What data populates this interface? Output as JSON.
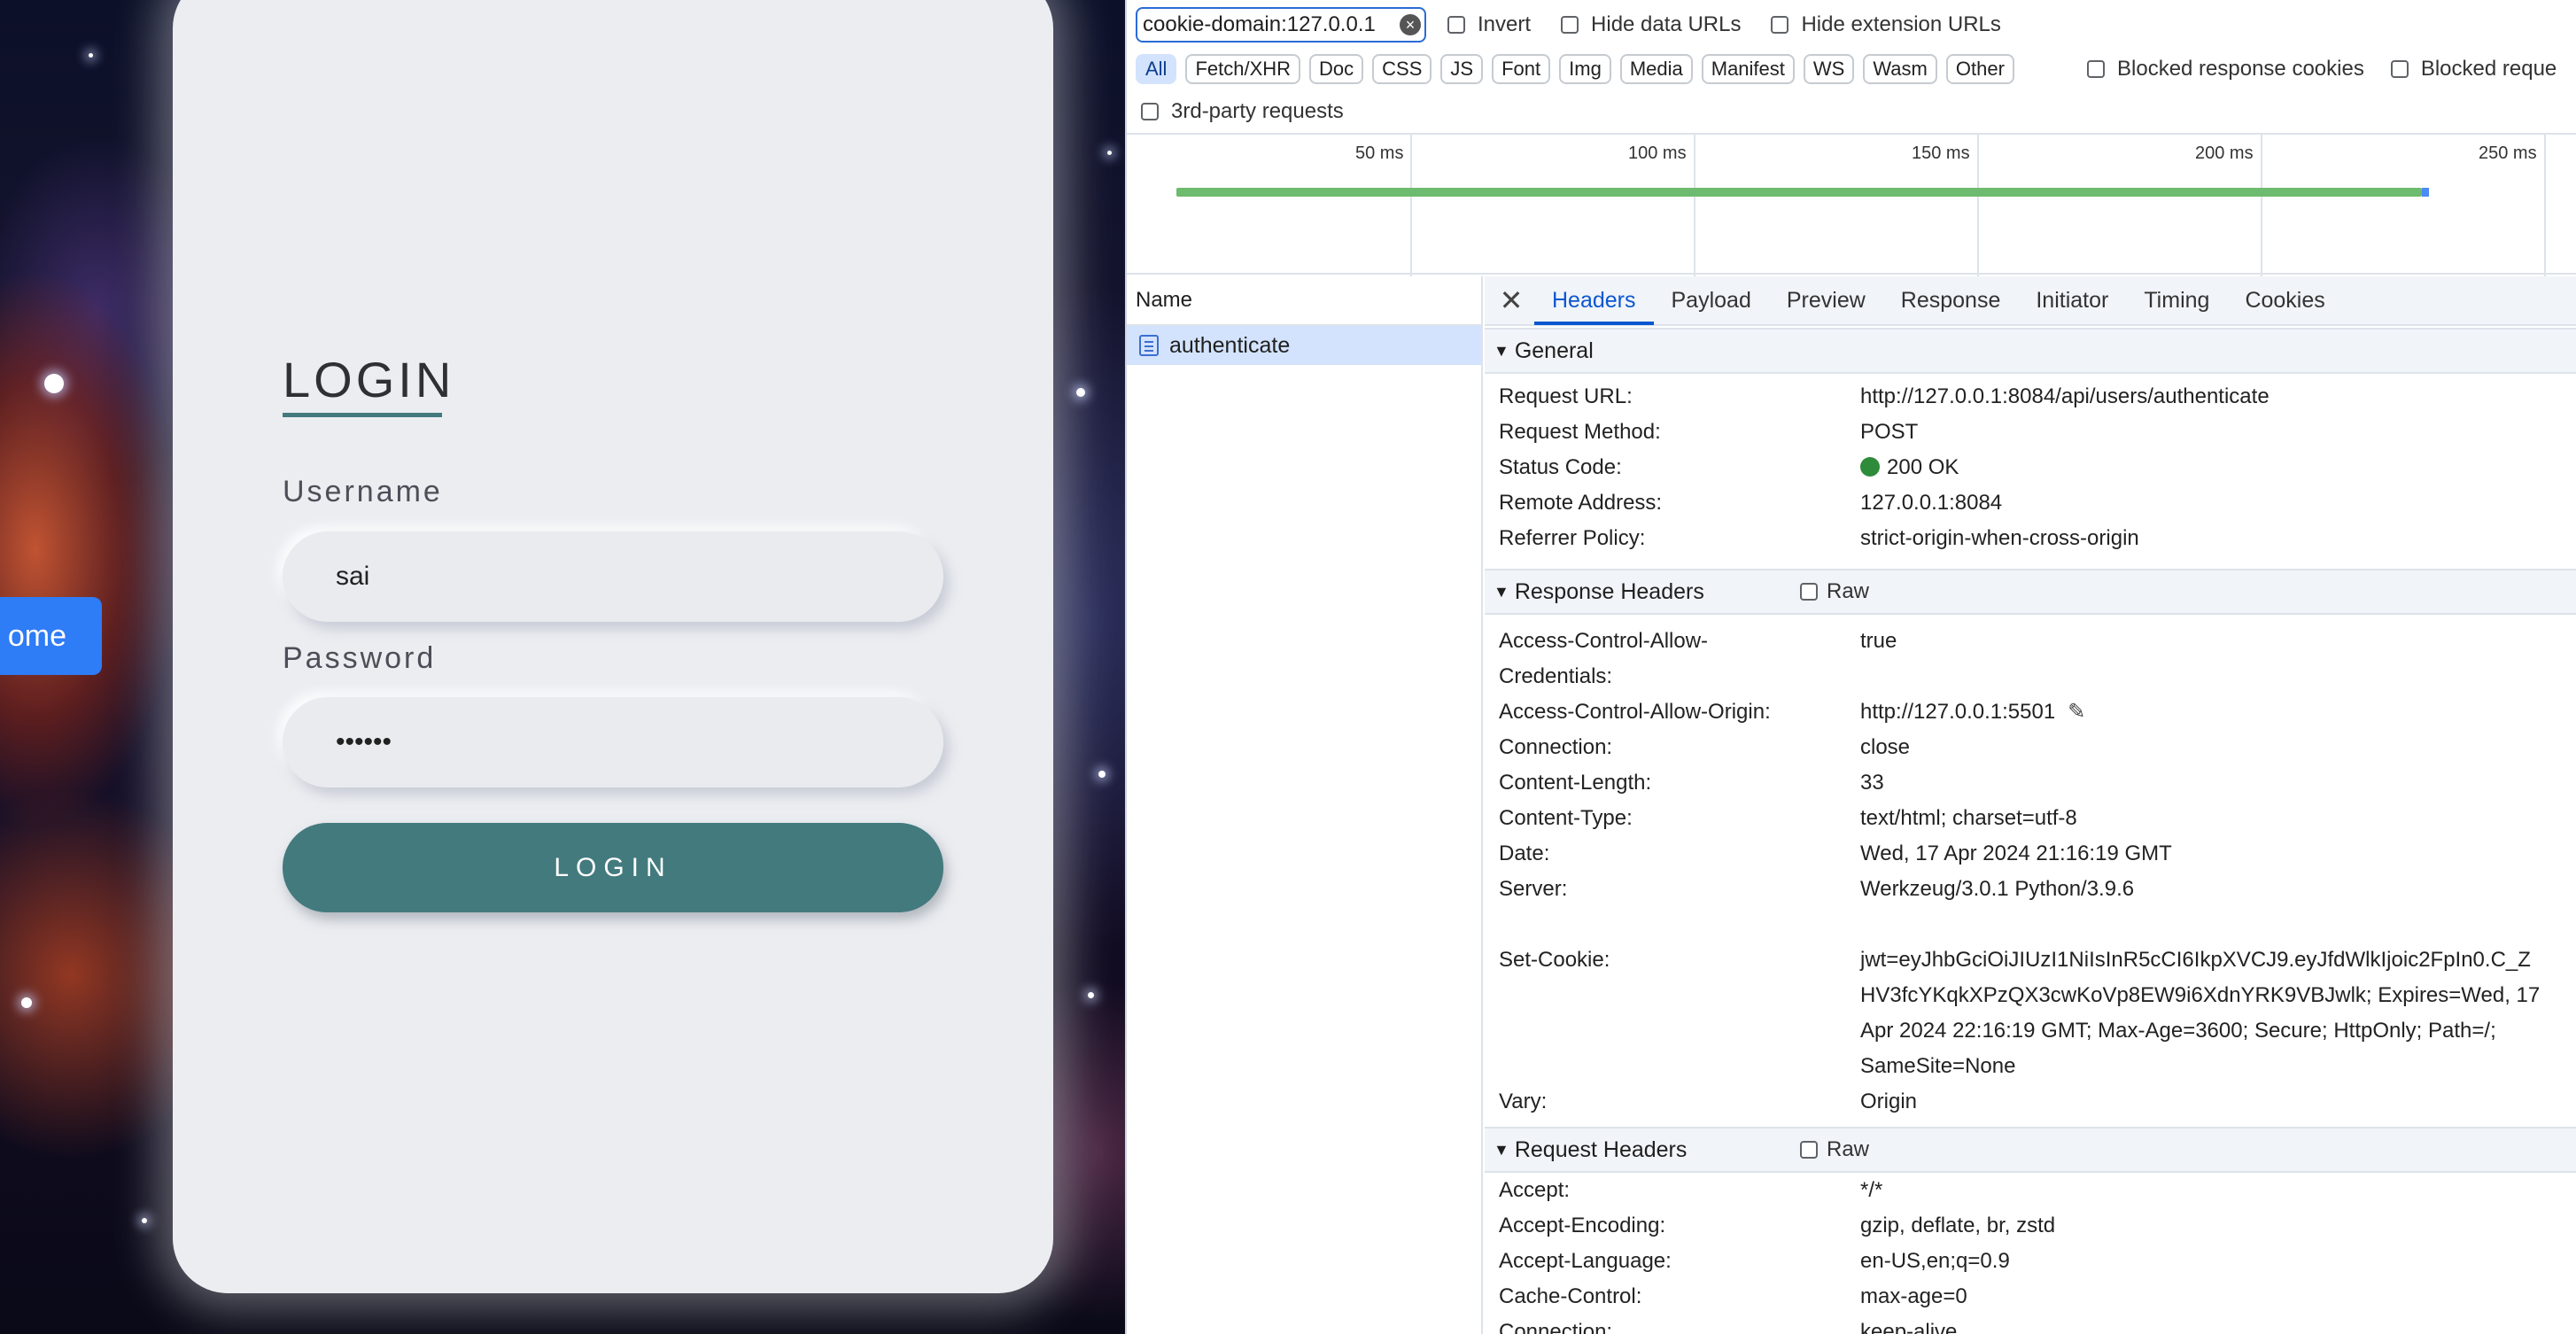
{
  "login_page": {
    "title": "LOGIN",
    "username_label": "Username",
    "username_value": "sai",
    "password_label": "Password",
    "password_value": "••••••",
    "login_button": "LOGIN",
    "home_button": "ome"
  },
  "devtools": {
    "filter_value": "cookie-domain:127.0.0.1",
    "filter_clear_icon": "clear-circle-icon",
    "invert": "Invert",
    "hide_data_urls": "Hide data URLs",
    "hide_extension_urls": "Hide extension URLs",
    "type_filters": [
      "All",
      "Fetch/XHR",
      "Doc",
      "CSS",
      "JS",
      "Font",
      "Img",
      "Media",
      "Manifest",
      "WS",
      "Wasm",
      "Other"
    ],
    "active_filter": "All",
    "blocked_response_cookies": "Blocked response cookies",
    "blocked_requests": "Blocked reque",
    "third_party": "3rd-party requests",
    "timeline_ticks": [
      "50 ms",
      "100 ms",
      "150 ms",
      "200 ms",
      "250 ms"
    ],
    "name_header": "Name",
    "request_name": "authenticate",
    "tabs": [
      "Headers",
      "Payload",
      "Preview",
      "Response",
      "Initiator",
      "Timing",
      "Cookies"
    ],
    "active_tab": "Headers",
    "general": {
      "title": "General",
      "rows": [
        {
          "k": "Request URL:",
          "v": "http://127.0.0.1:8084/api/users/authenticate"
        },
        {
          "k": "Request Method:",
          "v": "POST"
        },
        {
          "k": "Status Code:",
          "v": "200 OK"
        },
        {
          "k": "Remote Address:",
          "v": "127.0.0.1:8084"
        },
        {
          "k": "Referrer Policy:",
          "v": "strict-origin-when-cross-origin"
        }
      ]
    },
    "response_headers": {
      "title": "Response Headers",
      "raw": "Raw",
      "acac_k1": "Access-Control-Allow-",
      "acac_k2": "Credentials:",
      "acac_v": "true",
      "acao_k": "Access-Control-Allow-Origin:",
      "acao_v": "http://127.0.0.1:5501",
      "rows": [
        {
          "k": "Connection:",
          "v": "close"
        },
        {
          "k": "Content-Length:",
          "v": "33"
        },
        {
          "k": "Content-Type:",
          "v": "text/html; charset=utf-8"
        },
        {
          "k": "Date:",
          "v": "Wed, 17 Apr 2024 21:16:19 GMT"
        },
        {
          "k": "Server:",
          "v": "Werkzeug/3.0.1 Python/3.9.6"
        }
      ],
      "set_cookie_k": "Set-Cookie:",
      "set_cookie_lines": [
        "jwt=eyJhbGciOiJIUzI1NiIsInR5cCI6IkpXVCJ9.eyJfdWlkIjoic2FpIn0.C_Z",
        "HV3fcYKqkXPzQX3cwKoVp8EW9i6XdnYRK9VBJwlk; Expires=Wed, 17",
        "Apr 2024 22:16:19 GMT; Max-Age=3600; Secure; HttpOnly; Path=/;",
        "SameSite=None"
      ],
      "vary_k": "Vary:",
      "vary_v": "Origin"
    },
    "request_headers": {
      "title": "Request Headers",
      "raw": "Raw",
      "rows": [
        {
          "k": "Accept:",
          "v": "*/*"
        },
        {
          "k": "Accept-Encoding:",
          "v": "gzip, deflate, br, zstd"
        },
        {
          "k": "Accept-Language:",
          "v": "en-US,en;q=0.9"
        },
        {
          "k": "Cache-Control:",
          "v": "max-age=0"
        },
        {
          "k": "Connection:",
          "v": "keep-alive"
        }
      ]
    },
    "colors": {
      "accent": "#0b57d0",
      "status_ok": "#2e8b3a",
      "login_teal": "#437a7e"
    }
  }
}
